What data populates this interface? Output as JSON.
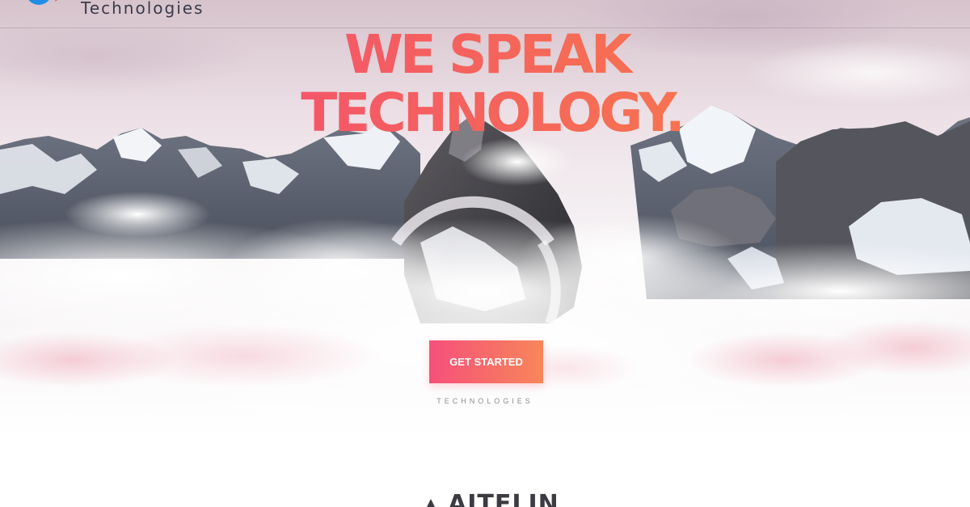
{
  "header": {
    "brand_text": "Technologies"
  },
  "hero": {
    "headline_line1": "WE SPEAK",
    "headline_line2": "TECHNOLOGY.",
    "cta_label": "GET STARTED",
    "tagline": "TECHNOLOGIES"
  },
  "footer_logo": {
    "wordmark": "AITELIN"
  },
  "colors": {
    "accent_pink": "#f0457a",
    "accent_orange": "#f7893f",
    "logo_blue": "#1f8ee6",
    "logo_red": "#e0303a"
  },
  "icons": {
    "brand_logo": "brand-logo-icon",
    "footer_logo": "footer-logo-icon"
  }
}
